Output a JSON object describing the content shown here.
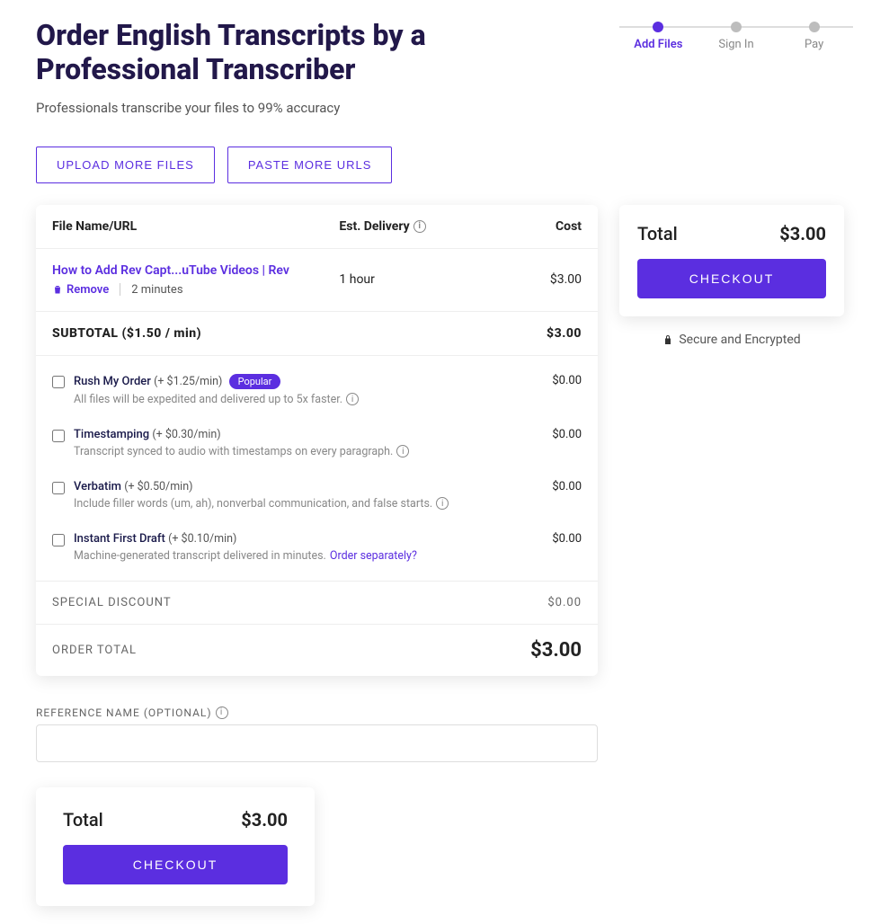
{
  "header": {
    "title": "Order English Transcripts by a Professional Transcriber",
    "subtitle": "Professionals transcribe your files to 99% accuracy"
  },
  "stepper": {
    "step1": "Add Files",
    "step2": "Sign In",
    "step3": "Pay"
  },
  "actions": {
    "upload_more": "UPLOAD MORE FILES",
    "paste_more": "PASTE MORE URLS"
  },
  "table": {
    "col_file": "File Name/URL",
    "col_delivery": "Est. Delivery",
    "col_cost": "Cost"
  },
  "file": {
    "name": "How to Add Rev Capt...uTube Videos | Rev",
    "remove": "Remove",
    "duration": "2 minutes",
    "delivery": "1 hour",
    "cost": "$3.00"
  },
  "subtotal": {
    "label": "SUBTOTAL ($1.50 / min)",
    "value": "$3.00"
  },
  "options": {
    "rush": {
      "title": "Rush My Order",
      "price": "(+ $1.25/min)",
      "badge": "Popular",
      "desc": "All files will be expedited and delivered up to 5x faster.",
      "cost": "$0.00"
    },
    "timestamp": {
      "title": "Timestamping",
      "price": "(+ $0.30/min)",
      "desc": "Transcript synced to audio with timestamps on every paragraph.",
      "cost": "$0.00"
    },
    "verbatim": {
      "title": "Verbatim",
      "price": "(+ $0.50/min)",
      "desc": "Include filler words (um, ah), nonverbal communication, and false starts.",
      "cost": "$0.00"
    },
    "instant": {
      "title": "Instant First Draft",
      "price": "(+ $0.10/min)",
      "desc": "Machine-generated transcript delivered in minutes.",
      "link": "Order separately?",
      "cost": "$0.00"
    }
  },
  "discount": {
    "label": "SPECIAL DISCOUNT",
    "value": "$0.00"
  },
  "order_total": {
    "label": "ORDER TOTAL",
    "value": "$3.00"
  },
  "sidebar": {
    "total_label": "Total",
    "total_value": "$3.00",
    "checkout": "CHECKOUT",
    "secure": "Secure and Encrypted"
  },
  "reference": {
    "label": "REFERENCE NAME (OPTIONAL)"
  },
  "bottom_total": {
    "total_label": "Total",
    "total_value": "$3.00",
    "checkout": "CHECKOUT"
  }
}
